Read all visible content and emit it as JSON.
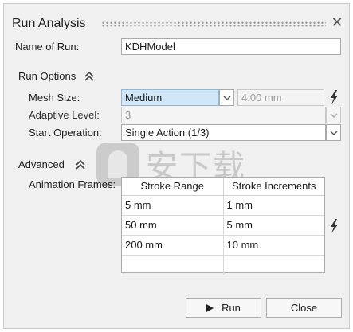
{
  "dialog": {
    "title": "Run Analysis",
    "close_glyph": "✕"
  },
  "name_of_run": {
    "label": "Name of Run:",
    "value": "KDHModel"
  },
  "run_options": {
    "header": "Run Options",
    "mesh_size": {
      "label": "Mesh Size:",
      "value": "Medium",
      "mm_value": "4.00 mm"
    },
    "adaptive_level": {
      "label": "Adaptive Level:",
      "value": "3"
    },
    "start_operation": {
      "label": "Start Operation:",
      "value": "Single Action (1/3)"
    }
  },
  "advanced": {
    "header": "Advanced",
    "animation_frames": {
      "label": "Animation Frames:",
      "columns": [
        "Stroke Range",
        "Stroke Increments"
      ],
      "rows": [
        [
          "5 mm",
          "1 mm"
        ],
        [
          "50 mm",
          "5 mm"
        ],
        [
          "200 mm",
          "10 mm"
        ],
        [
          "",
          ""
        ]
      ]
    }
  },
  "footer": {
    "run_label": "Run",
    "close_label": "Close"
  },
  "watermark": {
    "text": "安下载"
  },
  "icons": {
    "collapse": "double-chevron-up-icon",
    "bolt": "lightning-bolt-icon",
    "dropdown": "chevron-down-icon",
    "play": "play-icon",
    "close": "close-icon"
  },
  "colors": {
    "dialog_bg": "#f0f0f0",
    "selected_field": "#cfe7f7",
    "border": "#a9a9a9"
  }
}
